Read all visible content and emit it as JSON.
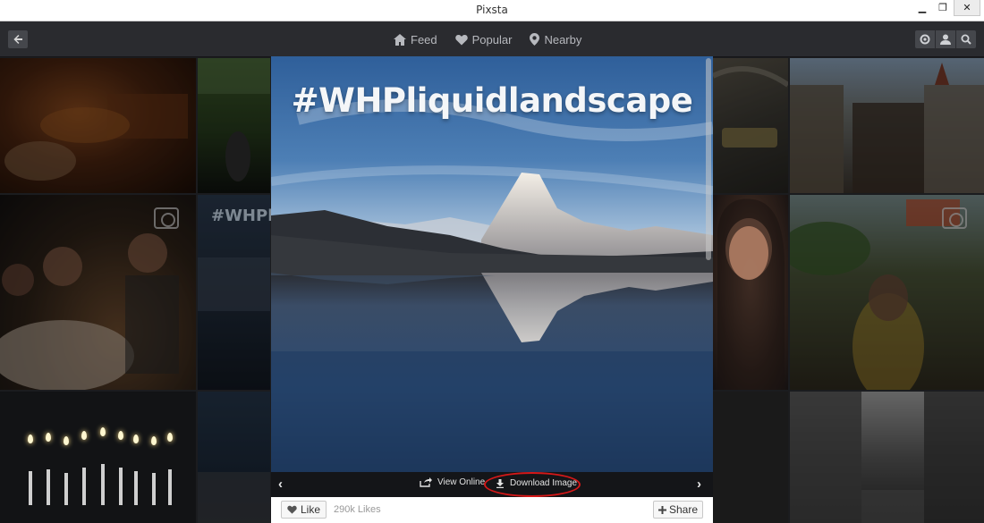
{
  "window": {
    "title": "Pixsta",
    "controls": {
      "minimize": "▁",
      "maximize": "❐",
      "close": "✕"
    }
  },
  "nav": {
    "back_icon": "arrow-left-icon",
    "items": [
      {
        "label": "Feed",
        "icon": "home-icon"
      },
      {
        "label": "Popular",
        "icon": "heart-icon"
      },
      {
        "label": "Nearby",
        "icon": "map-pin-icon"
      }
    ],
    "right_buttons": [
      "instagram-search-icon",
      "user-icon",
      "search-icon"
    ]
  },
  "viewer": {
    "hashtag": "#WHPliquidlandscape",
    "view_online_label": "View Online",
    "download_label": "Download Image",
    "prev_arrow": "‹",
    "next_arrow": "›",
    "like_label": "Like",
    "likes_count": "290k Likes",
    "share_label": "Share",
    "highlight_color": "#d41818"
  },
  "grid": {
    "ghost_text": "#WHPli"
  }
}
